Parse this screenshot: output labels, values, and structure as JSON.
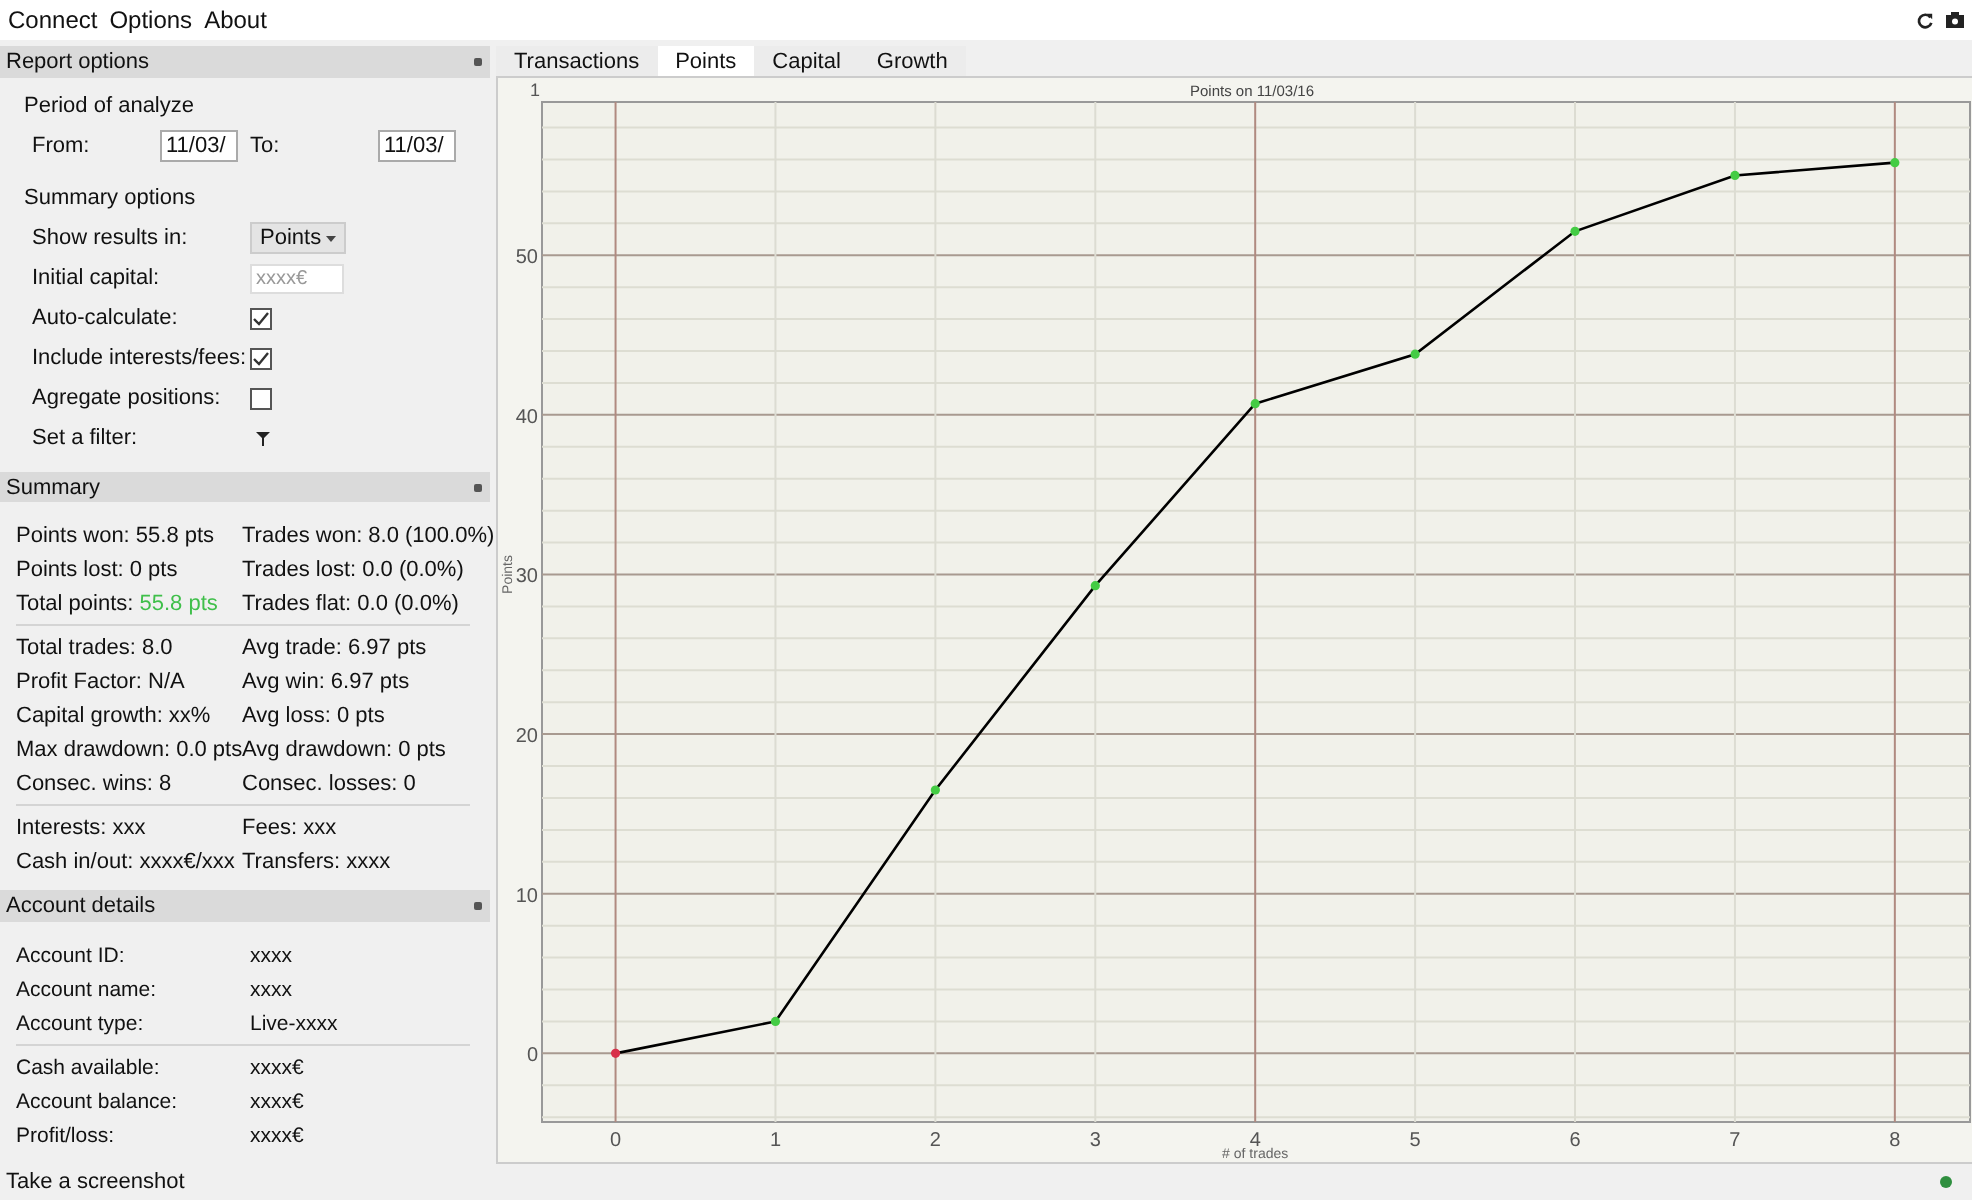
{
  "menu": [
    "Connect",
    "Options",
    "About"
  ],
  "report_options": {
    "title": "Report options",
    "period_title": "Period of analyze",
    "from_label": "From:",
    "from_value": "11/03/",
    "to_label": "To:",
    "to_value": "11/03/",
    "summary_title": "Summary options",
    "rows": [
      {
        "kind": "select",
        "label": "Show results in:",
        "value": "Points"
      },
      {
        "kind": "input",
        "label": "Initial capital:",
        "placeholder": "xxxx€"
      },
      {
        "kind": "checkbox",
        "label": "Auto-calculate:",
        "checked": true
      },
      {
        "kind": "checkbox",
        "label": "Include interests/fees:",
        "checked": true
      },
      {
        "kind": "checkbox",
        "label": "Agregate positions:",
        "checked": false
      },
      {
        "kind": "filter",
        "label": "Set a filter:"
      }
    ]
  },
  "summary": {
    "title": "Summary",
    "groups": [
      [
        [
          "Points won: 55.8 pts",
          "Trades won: 8.0 (100.0%)"
        ],
        [
          "Points lost: 0 pts",
          "Trades lost: 0.0 (0.0%)"
        ],
        [
          "Total points: ",
          "55.8 pts",
          "Trades flat: 0.0 (0.0%)"
        ]
      ],
      [
        [
          "Total trades: 8.0",
          "Avg trade: 6.97 pts"
        ],
        [
          "Profit Factor: N/A",
          "Avg win: 6.97 pts"
        ],
        [
          "Capital growth: xx%",
          "Avg loss: 0 pts"
        ],
        [
          "Max drawdown: 0.0 pts",
          "Avg drawdown: 0 pts"
        ],
        [
          "Consec. wins: 8",
          "Consec. losses: 0"
        ]
      ],
      [
        [
          "Interests: xxx",
          "Fees: xxx"
        ],
        [
          "Cash in/out: xxxx€/xxx",
          "Transfers: xxxx"
        ]
      ]
    ]
  },
  "account": {
    "title": "Account details",
    "groups": [
      [
        [
          "Account ID:",
          "xxxx"
        ],
        [
          "Account name:",
          "xxxx"
        ],
        [
          "Account type:",
          "Live-xxxx"
        ]
      ],
      [
        [
          "Cash available:",
          "xxxx€"
        ],
        [
          "Account balance:",
          "xxxx€"
        ],
        [
          "Profit/loss:",
          "xxxx€"
        ]
      ]
    ]
  },
  "tabs": [
    {
      "label": "Transactions",
      "selected": false
    },
    {
      "label": "Points",
      "selected": true
    },
    {
      "label": "Capital",
      "selected": false
    },
    {
      "label": "Growth",
      "selected": false
    }
  ],
  "chart_corner": "1",
  "chart_data": {
    "type": "line",
    "title": "Points on 11/03/16",
    "xlabel": "# of trades",
    "grid": true,
    "x": [
      0,
      1,
      2,
      3,
      4,
      5,
      6,
      7,
      8
    ],
    "series": [
      {
        "name": "Points",
        "color": "#000000",
        "marker": "circle",
        "values": [
          0,
          2,
          16.5,
          29.3,
          40.7,
          43.8,
          51.5,
          55,
          55.8
        ]
      }
    ],
    "xlim": [
      -0.46,
      8.47
    ],
    "ylim": [
      -4.3,
      59.6
    ],
    "xticks": [
      0,
      1,
      2,
      3,
      4,
      5,
      6,
      7,
      8
    ],
    "yticks": [
      0,
      10,
      20,
      30,
      40,
      50
    ]
  },
  "status": {
    "text": "Take a screenshot",
    "connected": true
  }
}
